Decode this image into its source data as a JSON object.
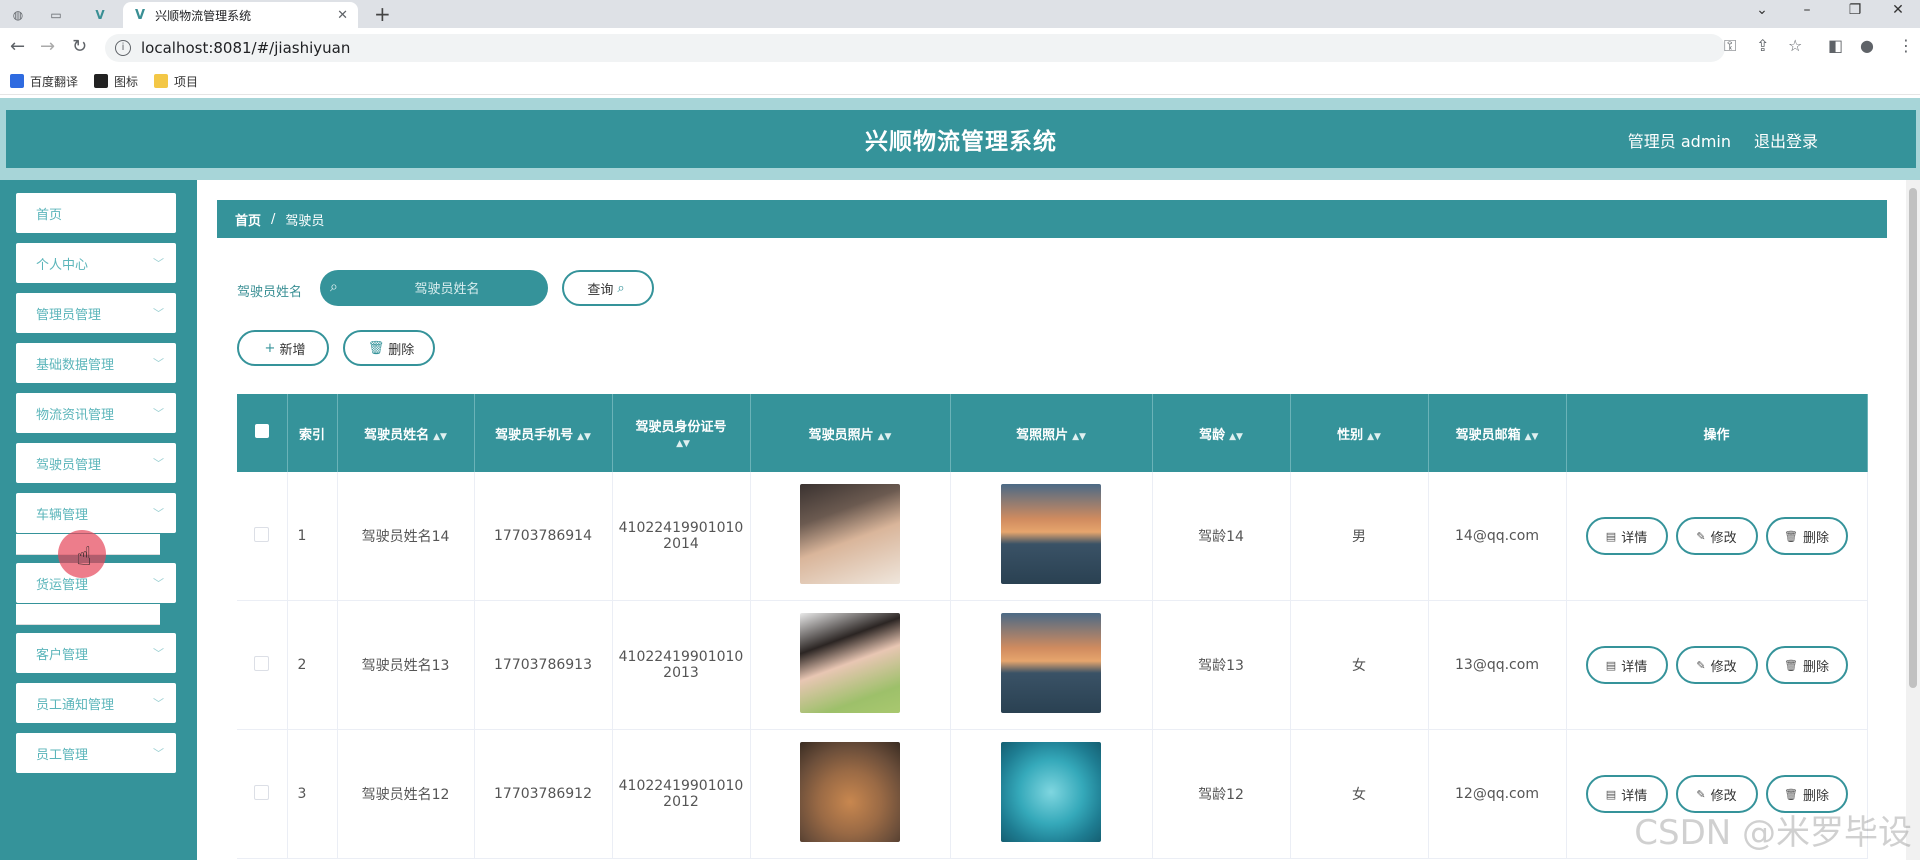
{
  "browser": {
    "tab_title": "兴顺物流管理系统",
    "url": "localhost:8081/#/jiashiyuan",
    "bookmarks": [
      {
        "label": "百度翻译",
        "color": "#2f6be0"
      },
      {
        "label": "图标",
        "color": "#222222"
      },
      {
        "label": "项目",
        "color": "#f3c746"
      }
    ]
  },
  "header": {
    "title": "兴顺物流管理系统",
    "admin_label": "管理员 admin",
    "logout_label": "退出登录"
  },
  "sidebar": {
    "items": [
      {
        "label": "首页"
      },
      {
        "label": "个人中心"
      },
      {
        "label": "管理员管理"
      },
      {
        "label": "基础数据管理"
      },
      {
        "label": "物流资讯管理"
      },
      {
        "label": "驾驶员管理"
      },
      {
        "label": "车辆管理"
      },
      {
        "label": "货运管理"
      },
      {
        "label": "客户管理"
      },
      {
        "label": "员工通知管理"
      },
      {
        "label": "员工管理"
      }
    ],
    "submenu_vehicle": "车辆管理",
    "submenu_freight": "货运管理"
  },
  "breadcrumb": {
    "home": "首页",
    "separator": "/",
    "current": "驾驶员"
  },
  "search": {
    "label": "驾驶员姓名",
    "placeholder": "驾驶员姓名",
    "query_button": "查询"
  },
  "actions": {
    "add_label": "新增",
    "delete_label": "删除"
  },
  "table": {
    "headers": {
      "index": "索引",
      "name": "驾驶员姓名",
      "phone": "驾驶员手机号",
      "id_card": "驾驶员身份证号",
      "photo": "驾驶员照片",
      "license_photo": "驾照照片",
      "age": "驾龄",
      "gender": "性别",
      "email": "驾驶员邮箱",
      "ops": "操作"
    },
    "rows": [
      {
        "index": "1",
        "name": "驾驶员姓名14",
        "phone": "17703786914",
        "id_line1": "41022419901010",
        "id_line2": "2014",
        "age": "驾龄14",
        "gender": "男",
        "email": "14@qq.com",
        "photo": "photo-man",
        "license": "sunset-lake"
      },
      {
        "index": "2",
        "name": "驾驶员姓名13",
        "phone": "17703786913",
        "id_line1": "41022419901010",
        "id_line2": "2013",
        "age": "驾龄13",
        "gender": "女",
        "email": "13@qq.com",
        "photo": "photo-woman",
        "license": "sunset-lake"
      },
      {
        "index": "3",
        "name": "驾驶员姓名12",
        "phone": "17703786912",
        "id_line1": "41022419901010",
        "id_line2": "2012",
        "age": "驾龄12",
        "gender": "女",
        "email": "12@qq.com",
        "photo": "photo-cat",
        "license": "heart-island"
      }
    ],
    "op_labels": {
      "detail": "详情",
      "edit": "修改",
      "delete": "删除"
    }
  },
  "watermark": "CSDN @米罗毕设",
  "colors": {
    "accent": "#35939a",
    "header_band": "#a7d5d8"
  }
}
